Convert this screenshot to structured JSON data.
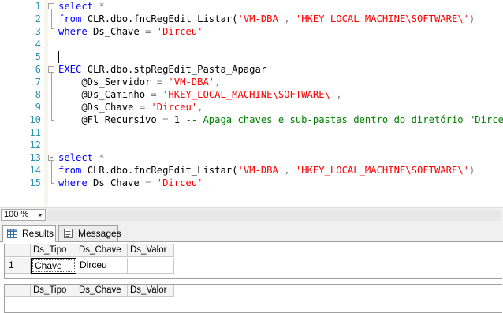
{
  "editor": {
    "line_numbers": [
      "1",
      "2",
      "3",
      "4",
      "5",
      "6",
      "7",
      "8",
      "9",
      "10",
      "11",
      "12",
      "13",
      "14",
      "15"
    ],
    "lines": {
      "l1_kw": "select",
      "l1_op": " *",
      "l2_kw": "from",
      "l2_obj": " CLR.dbo.fncRegEdit_Listar(",
      "l2_s1": "'VM-DBA'",
      "l2_sep": ", ",
      "l2_s2": "'HKEY_LOCAL_MACHINE\\SOFTWARE\\'",
      "l2_end": ")",
      "l3_kw": "where",
      "l3_col": " Ds_Chave ",
      "l3_op": "=",
      "l3_str": " 'Dirceu'",
      "l6_kw": "EXEC",
      "l6_obj": " CLR.dbo.stpRegEdit_Pasta_Apagar",
      "l7_param": "    @Ds_Servidor ",
      "l7_op": "=",
      "l7_str": " 'VM-DBA'",
      "l7_sep": ",",
      "l8_param": "    @Ds_Caminho ",
      "l8_op": "=",
      "l8_str": " 'HKEY_LOCAL_MACHINE\\SOFTWARE\\'",
      "l8_sep": ",",
      "l9_param": "    @Ds_Chave ",
      "l9_op": "=",
      "l9_str": " 'Dirceu'",
      "l9_sep": ",",
      "l10_param": "    @Fl_Recursivo ",
      "l10_op": "=",
      "l10_val": " 1 ",
      "l10_cm": "-- Apaga chaves e sub-pastas dentro do diretório \"Dirceu\"",
      "l13_kw": "select",
      "l13_op": " *",
      "l14_kw": "from",
      "l14_obj": " CLR.dbo.fncRegEdit_Listar(",
      "l14_s1": "'VM-DBA'",
      "l14_sep": ", ",
      "l14_s2": "'HKEY_LOCAL_MACHINE\\SOFTWARE\\'",
      "l14_end": ")",
      "l15_kw": "where",
      "l15_col": " Ds_Chave ",
      "l15_op": "=",
      "l15_str": " 'Dirceu'"
    }
  },
  "zoom": {
    "value": "100 %"
  },
  "tabs": {
    "results": "Results",
    "messages": "Messages"
  },
  "grid1": {
    "columns": [
      "Ds_Tipo",
      "Ds_Chave",
      "Ds_Valor"
    ],
    "rows": [
      {
        "num": "1",
        "Ds_Tipo": "Chave",
        "Ds_Chave": "Dirceu",
        "Ds_Valor": ""
      }
    ]
  },
  "grid2": {
    "columns": [
      "Ds_Tipo",
      "Ds_Chave",
      "Ds_Valor"
    ]
  },
  "colors": {
    "keyword": "#0000ff",
    "string": "#ff0000",
    "comment": "#008000",
    "line_number": "#2b91af",
    "operator": "#808080"
  },
  "icons": {
    "results_tab": "grid-icon",
    "messages_tab": "messages-icon"
  }
}
